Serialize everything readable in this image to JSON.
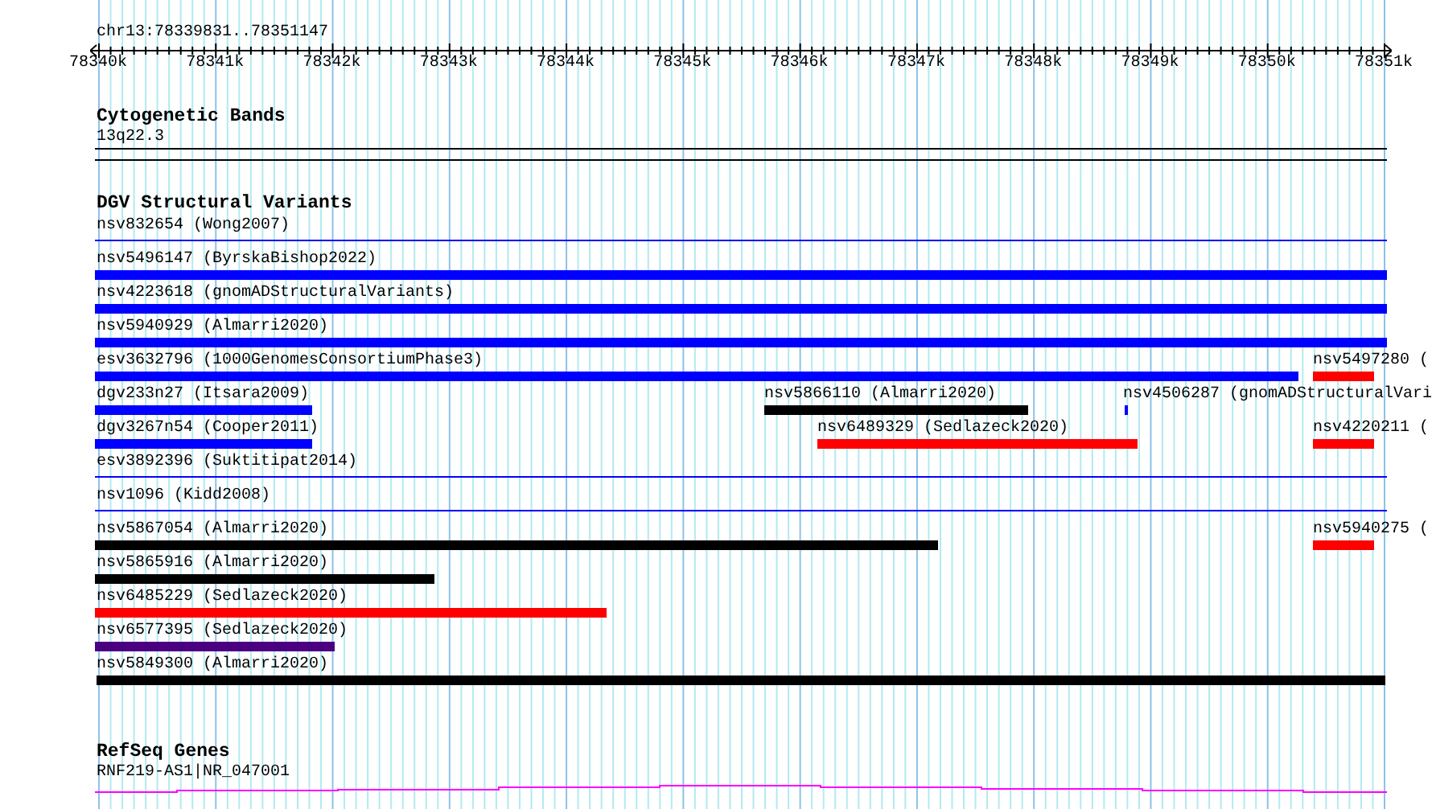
{
  "ruler": {
    "location": "chr13:78339831..78351147",
    "tick_labels": [
      "78340k",
      "78341k",
      "78342k",
      "78343k",
      "78344k",
      "78345k",
      "78346k",
      "78347k",
      "78348k",
      "78349k",
      "78350k",
      "78351k"
    ]
  },
  "tracks": [
    {
      "title": "Cytogenetic Bands",
      "kind": "bands",
      "features": [
        {
          "label": "13q22.3",
          "color": "#000000"
        }
      ]
    },
    {
      "title": "DGV Structural Variants",
      "kind": "variants",
      "features": [
        {
          "label": "nsv832654 (Wong2007)",
          "kind": "line",
          "color": "#0000ff"
        },
        {
          "label": "nsv5496147 (ByrskaBishop2022)",
          "kind": "bar",
          "color": "#0000ff"
        },
        {
          "label": "nsv4223618 (gnomADStructuralVariants)",
          "kind": "bar",
          "color": "#0000ff"
        },
        {
          "label": "nsv5940929 (Almarri2020)",
          "kind": "bar",
          "color": "#0000ff"
        },
        {
          "label": "esv3632796 (1000GenomesConsortiumPhase3)",
          "kind": "bar",
          "color": "#0000ff"
        },
        {
          "label": "nsv5497280 (",
          "kind": "bar",
          "color": "#ff0000"
        },
        {
          "label": "dgv233n27 (Itsara2009)",
          "kind": "bar",
          "color": "#0000ff"
        },
        {
          "label": "nsv5866110 (Almarri2020)",
          "kind": "bar",
          "color": "#000000"
        },
        {
          "label": "nsv4506287 (gnomADStructuralVari",
          "kind": "bar",
          "color": "#0000ff"
        },
        {
          "label": "dgv3267n54 (Cooper2011)",
          "kind": "bar",
          "color": "#0000ff"
        },
        {
          "label": "nsv6489329 (Sedlazeck2020)",
          "kind": "bar",
          "color": "#ff0000"
        },
        {
          "label": "nsv4220211 (",
          "kind": "bar",
          "color": "#ff0000"
        },
        {
          "label": "esv3892396 (Suktitipat2014)",
          "kind": "line",
          "color": "#0000ff"
        },
        {
          "label": "nsv1096 (Kidd2008)",
          "kind": "line",
          "color": "#0000ff"
        },
        {
          "label": "nsv5867054 (Almarri2020)",
          "kind": "bar",
          "color": "#000000"
        },
        {
          "label": "nsv5940275 (",
          "kind": "bar",
          "color": "#ff0000"
        },
        {
          "label": "nsv5865916 (Almarri2020)",
          "kind": "bar",
          "color": "#000000"
        },
        {
          "label": "nsv6485229 (Sedlazeck2020)",
          "kind": "bar",
          "color": "#ff0000"
        },
        {
          "label": "nsv6577395 (Sedlazeck2020)",
          "kind": "bar",
          "color": "#4b0082"
        },
        {
          "label": "nsv5849300 (Almarri2020)",
          "kind": "bar",
          "color": "#000000"
        }
      ]
    },
    {
      "title": "RefSeq Genes",
      "kind": "genes",
      "features": [
        {
          "label": "RNF219-AS1|NR_047001",
          "color": "#ff00ff"
        }
      ]
    }
  ]
}
